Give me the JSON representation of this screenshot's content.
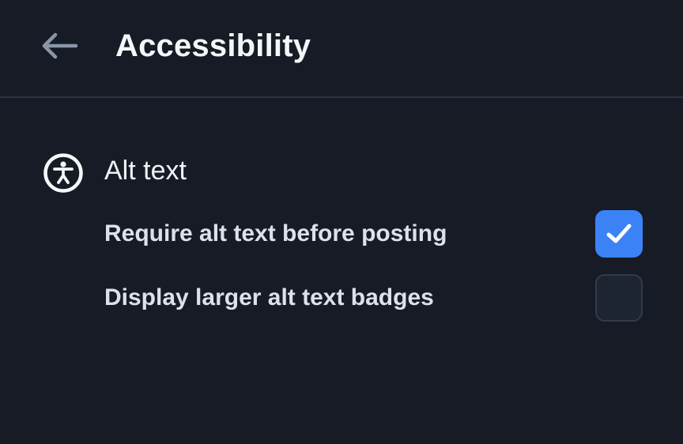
{
  "header": {
    "title": "Accessibility",
    "back_icon": "arrow-left-icon"
  },
  "section": {
    "icon": "accessibility-icon",
    "title": "Alt text",
    "options": [
      {
        "label": "Require alt text before posting",
        "checked": true
      },
      {
        "label": "Display larger alt text badges",
        "checked": false
      }
    ]
  },
  "colors": {
    "background": "#161b26",
    "accent": "#3b82f6",
    "divider": "#2c3443"
  }
}
